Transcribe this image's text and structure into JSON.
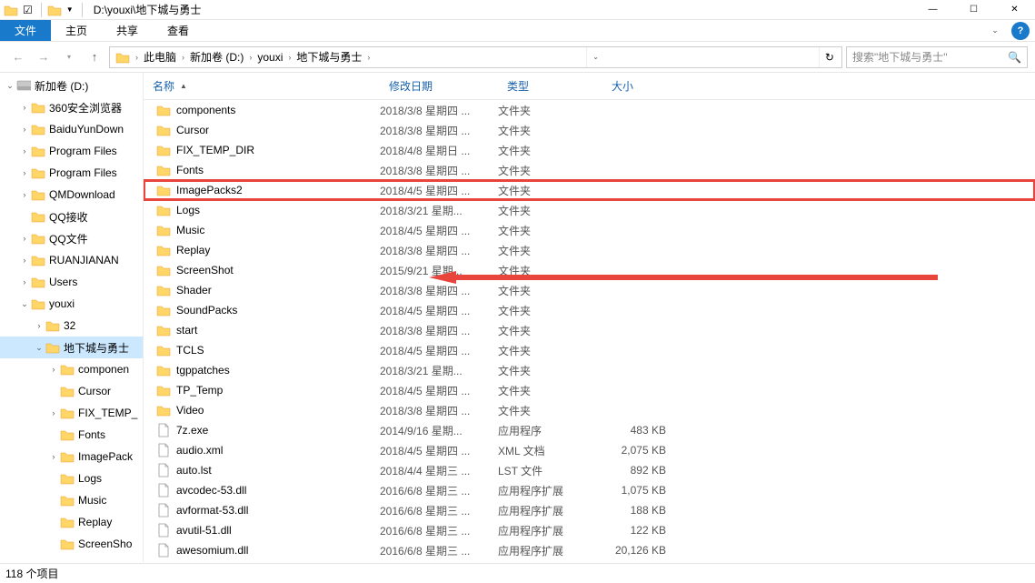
{
  "window": {
    "title": "D:\\youxi\\地下城与勇士"
  },
  "ribbon": {
    "file": "文件",
    "tabs": [
      "主页",
      "共享",
      "查看"
    ]
  },
  "breadcrumb": {
    "root_icon": "pc",
    "items": [
      "此电脑",
      "新加卷 (D:)",
      "youxi",
      "地下城与勇士"
    ]
  },
  "search": {
    "placeholder": "搜索\"地下城与勇士\""
  },
  "columns": {
    "name": "名称",
    "date": "修改日期",
    "type": "类型",
    "size": "大小"
  },
  "tree": [
    {
      "label": "新加卷 (D:)",
      "indent": 0,
      "icon": "drive",
      "twisty": "open"
    },
    {
      "label": "360安全浏览器",
      "indent": 1,
      "icon": "folder",
      "twisty": "closed"
    },
    {
      "label": "BaiduYunDown",
      "indent": 1,
      "icon": "folder",
      "twisty": "closed"
    },
    {
      "label": "Program Files",
      "indent": 1,
      "icon": "folder",
      "twisty": "closed"
    },
    {
      "label": "Program Files",
      "indent": 1,
      "icon": "folder",
      "twisty": "closed"
    },
    {
      "label": "QMDownload",
      "indent": 1,
      "icon": "folder",
      "twisty": "closed"
    },
    {
      "label": "QQ接收",
      "indent": 1,
      "icon": "folder",
      "twisty": ""
    },
    {
      "label": "QQ文件",
      "indent": 1,
      "icon": "folder",
      "twisty": "closed"
    },
    {
      "label": "RUANJIANAN",
      "indent": 1,
      "icon": "folder",
      "twisty": "closed"
    },
    {
      "label": "Users",
      "indent": 1,
      "icon": "folder",
      "twisty": "closed"
    },
    {
      "label": "youxi",
      "indent": 1,
      "icon": "folder",
      "twisty": "open"
    },
    {
      "label": "32",
      "indent": 2,
      "icon": "folder",
      "twisty": "closed"
    },
    {
      "label": "地下城与勇士",
      "indent": 2,
      "icon": "folder",
      "twisty": "open",
      "selected": true
    },
    {
      "label": "componen",
      "indent": 3,
      "icon": "folder",
      "twisty": "closed"
    },
    {
      "label": "Cursor",
      "indent": 3,
      "icon": "folder",
      "twisty": ""
    },
    {
      "label": "FIX_TEMP_",
      "indent": 3,
      "icon": "folder",
      "twisty": "closed"
    },
    {
      "label": "Fonts",
      "indent": 3,
      "icon": "folder",
      "twisty": ""
    },
    {
      "label": "ImagePack",
      "indent": 3,
      "icon": "folder",
      "twisty": "closed"
    },
    {
      "label": "Logs",
      "indent": 3,
      "icon": "folder",
      "twisty": ""
    },
    {
      "label": "Music",
      "indent": 3,
      "icon": "folder",
      "twisty": ""
    },
    {
      "label": "Replay",
      "indent": 3,
      "icon": "folder",
      "twisty": ""
    },
    {
      "label": "ScreenSho",
      "indent": 3,
      "icon": "folder",
      "twisty": ""
    }
  ],
  "files": [
    {
      "name": "components",
      "date": "2018/3/8 星期四 ...",
      "type": "文件夹",
      "size": "",
      "icon": "folder"
    },
    {
      "name": "Cursor",
      "date": "2018/3/8 星期四 ...",
      "type": "文件夹",
      "size": "",
      "icon": "folder"
    },
    {
      "name": "FIX_TEMP_DIR",
      "date": "2018/4/8 星期日 ...",
      "type": "文件夹",
      "size": "",
      "icon": "folder"
    },
    {
      "name": "Fonts",
      "date": "2018/3/8 星期四 ...",
      "type": "文件夹",
      "size": "",
      "icon": "folder"
    },
    {
      "name": "ImagePacks2",
      "date": "2018/4/5 星期四 ...",
      "type": "文件夹",
      "size": "",
      "icon": "folder",
      "highlight": true
    },
    {
      "name": "Logs",
      "date": "2018/3/21 星期...",
      "type": "文件夹",
      "size": "",
      "icon": "folder"
    },
    {
      "name": "Music",
      "date": "2018/4/5 星期四 ...",
      "type": "文件夹",
      "size": "",
      "icon": "folder"
    },
    {
      "name": "Replay",
      "date": "2018/3/8 星期四 ...",
      "type": "文件夹",
      "size": "",
      "icon": "folder"
    },
    {
      "name": "ScreenShot",
      "date": "2015/9/21 星期...",
      "type": "文件夹",
      "size": "",
      "icon": "folder"
    },
    {
      "name": "Shader",
      "date": "2018/3/8 星期四 ...",
      "type": "文件夹",
      "size": "",
      "icon": "folder"
    },
    {
      "name": "SoundPacks",
      "date": "2018/4/5 星期四 ...",
      "type": "文件夹",
      "size": "",
      "icon": "folder"
    },
    {
      "name": "start",
      "date": "2018/3/8 星期四 ...",
      "type": "文件夹",
      "size": "",
      "icon": "folder"
    },
    {
      "name": "TCLS",
      "date": "2018/4/5 星期四 ...",
      "type": "文件夹",
      "size": "",
      "icon": "folder"
    },
    {
      "name": "tgppatches",
      "date": "2018/3/21 星期...",
      "type": "文件夹",
      "size": "",
      "icon": "folder"
    },
    {
      "name": "TP_Temp",
      "date": "2018/4/5 星期四 ...",
      "type": "文件夹",
      "size": "",
      "icon": "folder"
    },
    {
      "name": "Video",
      "date": "2018/3/8 星期四 ...",
      "type": "文件夹",
      "size": "",
      "icon": "folder"
    },
    {
      "name": "7z.exe",
      "date": "2014/9/16 星期...",
      "type": "应用程序",
      "size": "483 KB",
      "icon": "exe"
    },
    {
      "name": "audio.xml",
      "date": "2018/4/5 星期四 ...",
      "type": "XML 文档",
      "size": "2,075 KB",
      "icon": "xml"
    },
    {
      "name": "auto.lst",
      "date": "2018/4/4 星期三 ...",
      "type": "LST 文件",
      "size": "892 KB",
      "icon": "file"
    },
    {
      "name": "avcodec-53.dll",
      "date": "2016/6/8 星期三 ...",
      "type": "应用程序扩展",
      "size": "1,075 KB",
      "icon": "dll"
    },
    {
      "name": "avformat-53.dll",
      "date": "2016/6/8 星期三 ...",
      "type": "应用程序扩展",
      "size": "188 KB",
      "icon": "dll"
    },
    {
      "name": "avutil-51.dll",
      "date": "2016/6/8 星期三 ...",
      "type": "应用程序扩展",
      "size": "122 KB",
      "icon": "dll"
    },
    {
      "name": "awesomium.dll",
      "date": "2016/6/8 星期三 ...",
      "type": "应用程序扩展",
      "size": "20,126 KB",
      "icon": "dll"
    }
  ],
  "status": {
    "text": "118 个项目"
  }
}
